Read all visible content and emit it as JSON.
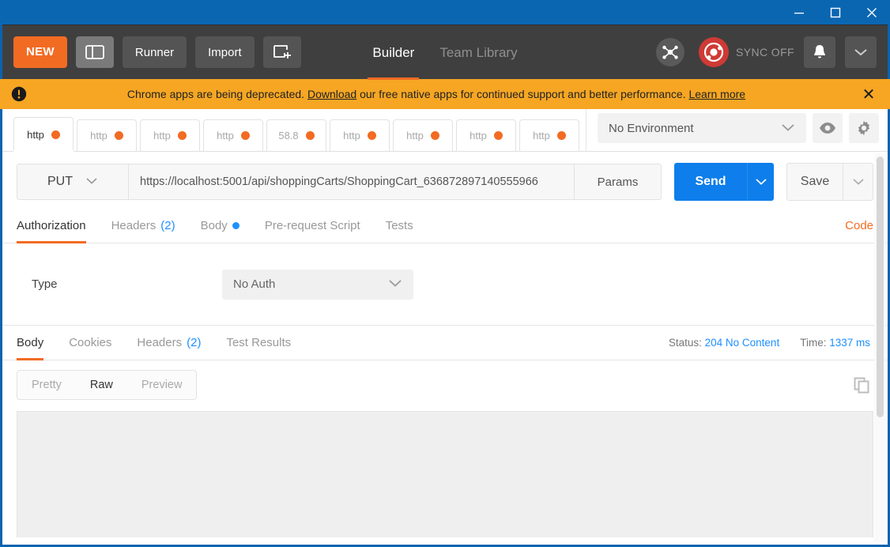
{
  "window": {
    "minimize_label": "Minimize",
    "maximize_label": "Maximize",
    "close_label": "Close"
  },
  "header": {
    "new_label": "NEW",
    "sidebar_toggle_label": "Toggle Sidebar",
    "runner_label": "Runner",
    "import_label": "Import",
    "new_window_label": "New Window",
    "nav_tabs": [
      {
        "label": "Builder",
        "active": true
      },
      {
        "label": "Team Library",
        "active": false
      }
    ],
    "sync_status": "SYNC OFF",
    "interceptor_label": "Interceptor",
    "notifications_label": "Notifications",
    "account_label": "Account menu"
  },
  "banner": {
    "text_before": "Chrome apps are being deprecated. ",
    "link1": "Download",
    "text_middle": " our free native apps for continued support and better performance. ",
    "link2": "Learn more",
    "close_label": "✕",
    "bg_color": "#f6a623"
  },
  "tabstrip": {
    "tabs": [
      {
        "label": "http",
        "active": true
      },
      {
        "label": "http",
        "active": false
      },
      {
        "label": "http",
        "active": false
      },
      {
        "label": "http",
        "active": false
      },
      {
        "label": "58.8",
        "active": false
      },
      {
        "label": "http",
        "active": false
      },
      {
        "label": "http",
        "active": false
      },
      {
        "label": "http",
        "active": false
      },
      {
        "label": "http",
        "active": false
      }
    ],
    "dot_color": "#f26b23",
    "environment": {
      "selected": "No Environment",
      "eye_label": "Environment quick look",
      "gear_label": "Manage environments"
    }
  },
  "request": {
    "method": "PUT",
    "url": "https://localhost:5001/api/shoppingCarts/ShoppingCart_636872897140555966",
    "params_label": "Params",
    "send_label": "Send",
    "send_caret_label": "Send options",
    "save_label": "Save",
    "save_caret_label": "Save options",
    "tabs": [
      {
        "label": "Authorization",
        "active": true,
        "count": "",
        "dot": false
      },
      {
        "label": "Headers",
        "active": false,
        "count": "(2)",
        "dot": false
      },
      {
        "label": "Body",
        "active": false,
        "count": "",
        "dot": true
      },
      {
        "label": "Pre-request Script",
        "active": false,
        "count": "",
        "dot": false
      },
      {
        "label": "Tests",
        "active": false,
        "count": "",
        "dot": false
      }
    ],
    "code_label": "Code"
  },
  "auth": {
    "type_label": "Type",
    "type_value": "No Auth"
  },
  "response": {
    "tabs": [
      {
        "label": "Body",
        "active": true,
        "count": ""
      },
      {
        "label": "Cookies",
        "active": false,
        "count": ""
      },
      {
        "label": "Headers",
        "active": false,
        "count": "(2)"
      },
      {
        "label": "Test Results",
        "active": false,
        "count": ""
      }
    ],
    "status_label": "Status:",
    "status_value": "204 No Content",
    "time_label": "Time:",
    "time_value": "1337 ms",
    "view_modes": [
      {
        "label": "Pretty",
        "active": false
      },
      {
        "label": "Raw",
        "active": true
      },
      {
        "label": "Preview",
        "active": false
      }
    ],
    "copy_label": "Copy to clipboard",
    "body_text": ""
  },
  "colors": {
    "accent_orange": "#f26b23",
    "accent_blue": "#1e90ff",
    "send_blue": "#0d7eeb",
    "header_dark": "#3f3f3f",
    "title_blue": "#0b66b2"
  }
}
